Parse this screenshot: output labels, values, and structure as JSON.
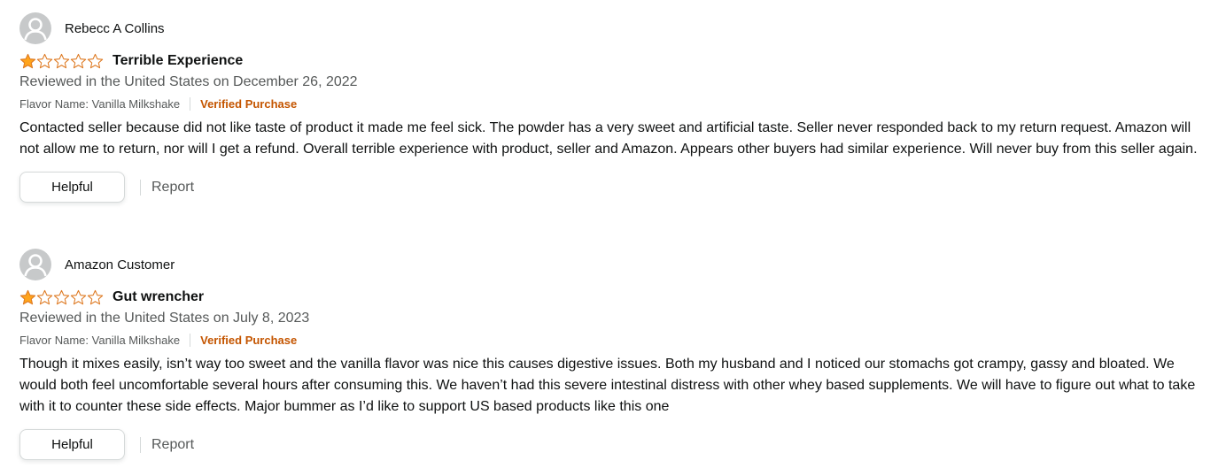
{
  "reviews": [
    {
      "profile_name": "Rebecc A Collins",
      "rating": 1,
      "max_rating": 5,
      "title": "Terrible Experience",
      "date": "Reviewed in the United States on December 26, 2022",
      "flavor": "Flavor Name: Vanilla Milkshake",
      "verified": "Verified Purchase",
      "body": "Contacted seller because did not like taste of product it made me feel sick. The powder has a very sweet and artificial taste. Seller never responded back to my return request. Amazon will not allow me to return, nor will I get a refund. Overall terrible experience with product, seller and Amazon. Appears other buyers had similar experience. Will never buy from this seller again.",
      "helpful_label": "Helpful",
      "report_label": "Report"
    },
    {
      "profile_name": "Amazon Customer",
      "rating": 1,
      "max_rating": 5,
      "title": "Gut wrencher",
      "date": "Reviewed in the United States on July 8, 2023",
      "flavor": "Flavor Name: Vanilla Milkshake",
      "verified": "Verified Purchase",
      "body": "Though it mixes easily, isn’t way too sweet and the vanilla flavor was nice this causes digestive issues. Both my husband and I noticed our stomachs got crampy, gassy and bloated. We would both feel uncomfortable several hours after consuming this. We haven’t had this severe intestinal distress with other whey based supplements. We will have to figure out what to take with it to counter these side effects. Major bummer as I’d like to support US based products like this one",
      "helpful_label": "Helpful",
      "report_label": "Report"
    }
  ],
  "colors": {
    "star_fill": "#ffa41c",
    "star_outline": "#de7921",
    "verified": "#c45500",
    "muted_text": "#565959"
  },
  "icons": {
    "avatar": "default-user-avatar-icon",
    "star_full": "star-filled-icon",
    "star_empty": "star-outline-icon"
  }
}
